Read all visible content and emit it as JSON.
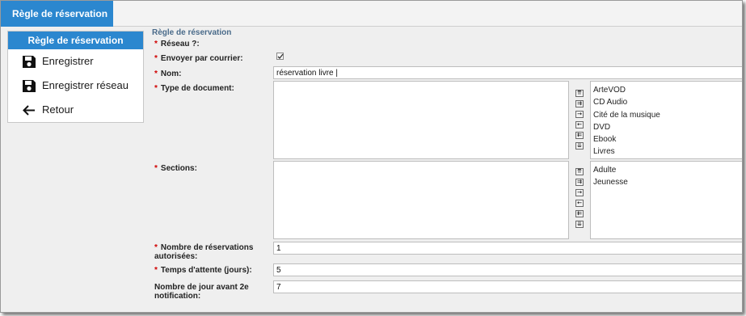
{
  "tab": {
    "label": "Règle de réservation"
  },
  "sidebar": {
    "header": "Règle de réservation",
    "items": [
      {
        "label": "Enregistrer",
        "icon": "save-icon"
      },
      {
        "label": "Enregistrer réseau",
        "icon": "save-icon"
      },
      {
        "label": "Retour",
        "icon": "arrow-left-icon"
      }
    ]
  },
  "form": {
    "section_title": "Règle de réservation",
    "required_mark": "*",
    "reseau_label": "Réseau ?:",
    "courrier_label": "Envoyer par courrier:",
    "courrier_checked": true,
    "nom_label": "Nom:",
    "nom_value": "réservation livre |",
    "type_doc_label": "Type de document:",
    "type_doc_options": [
      "ArteVOD",
      "CD Audio",
      "Cité de la musique",
      "DVD",
      "Ebook",
      "Livres"
    ],
    "sections_label": "Sections:",
    "sections_options": [
      "Adulte",
      "Jeunesse"
    ],
    "nb_reservations_label": "Nombre de réservations autorisées:",
    "nb_reservations_value": "1",
    "temps_attente_label": "Temps d'attente (jours):",
    "temps_attente_value": "5",
    "nb_jour_label": "Nombre de jour avant 2e notification:",
    "nb_jour_value": "7",
    "arrow_buttons": [
      "⇈",
      "⇉",
      "→",
      "←",
      "⇇",
      "⇊"
    ]
  },
  "colors": {
    "accent": "#2b87cf",
    "required": "#d00000",
    "section_title": "#4a6b8a"
  }
}
